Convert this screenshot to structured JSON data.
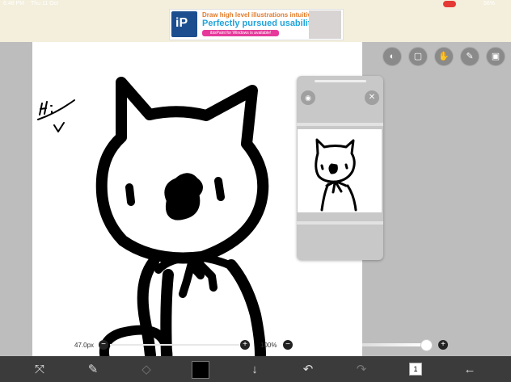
{
  "status_bar": {
    "time": "6:48 PM",
    "date": "Thu 11 Oct",
    "battery": "56%"
  },
  "ad": {
    "logo": "iP",
    "line1": "Draw high level illustrations intuitively!",
    "line2": "Perfectly pursued usability!",
    "line3": "ibisPaint for Windows is available!"
  },
  "brush": {
    "size_label": "47.0px",
    "minus_label": "−",
    "plus_label": "+"
  },
  "opacity": {
    "label": "100%",
    "minus_label": "−",
    "plus_label": "+",
    "value": 1.0
  },
  "layers": {
    "count": "1"
  },
  "colors": {
    "current": "#000000",
    "toolbar_bg": "#3b3b3b",
    "workspace_bg": "#bdbdbd"
  }
}
